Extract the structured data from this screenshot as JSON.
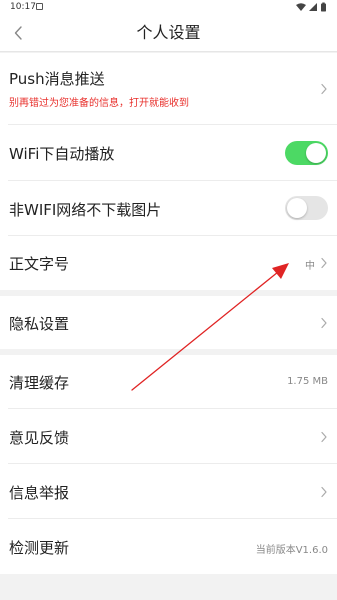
{
  "status_bar": {
    "time": "10:17",
    "icons": [
      "wifi-icon",
      "cellular-icon",
      "battery-icon"
    ]
  },
  "header": {
    "title": "个人设置",
    "back_icon": "chevron-left-icon"
  },
  "settings": {
    "push": {
      "label": "Push消息推送",
      "subtitle": "别再错过为您准备的信息，打开就能收到"
    },
    "wifi_autoplay": {
      "label": "WiFi下自动播放",
      "enabled": true
    },
    "no_image_non_wifi": {
      "label": "非WIFI网络不下载图片",
      "enabled": false
    },
    "font_size": {
      "label": "正文字号",
      "value": "中"
    },
    "privacy": {
      "label": "隐私设置"
    },
    "clear_cache": {
      "label": "清理缓存",
      "value": "1.75 MB"
    },
    "feedback": {
      "label": "意见反馈"
    },
    "report": {
      "label": "信息举报"
    },
    "check_update": {
      "label": "检测更新",
      "value": "当前版本V1.6.0"
    }
  },
  "colors": {
    "toggle_on": "#4cd964",
    "toggle_off": "#e5e5e5",
    "subtitle_red": "#e8302c",
    "annotation_arrow": "#e02424",
    "page_background": "#f2f2f2"
  }
}
